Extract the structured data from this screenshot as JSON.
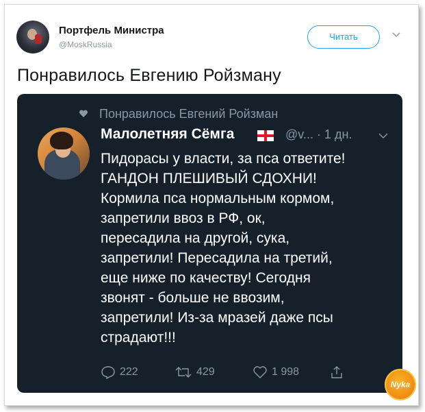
{
  "tweet": {
    "author_name": "Портфель Министра",
    "author_handle": "@MoskRussia",
    "follow_label": "Читать",
    "text": "Понравилось Евгению Ройзману"
  },
  "embedded": {
    "liked_by": "Понравилось Евгений Ройзман",
    "author_name": "Малолетняя Сёмга",
    "handle_time": "@v... · 1 дн.",
    "lines": [
      "Пидорасы у власти, за пса ответите!",
      "ГАНДОН ПЛЕШИВЫЙ СДОХНИ!",
      "Кормила пса нормальным кормом,",
      "запретили ввоз в РФ, ок,",
      "пересадила на другой, сука,",
      "запретили! Пересадила на третий,",
      "еще ниже по качеству! Сегодня",
      "звонят - больше не ввозим,",
      "запретили! Из-за мразей даже псы",
      "страдают!!!"
    ],
    "replies": "222",
    "retweets": "429",
    "likes": "1 998"
  },
  "watermark": "Nyka",
  "colors": {
    "accent": "#1da1f2",
    "dark_bg": "#15202b",
    "muted": "#8899a6"
  }
}
